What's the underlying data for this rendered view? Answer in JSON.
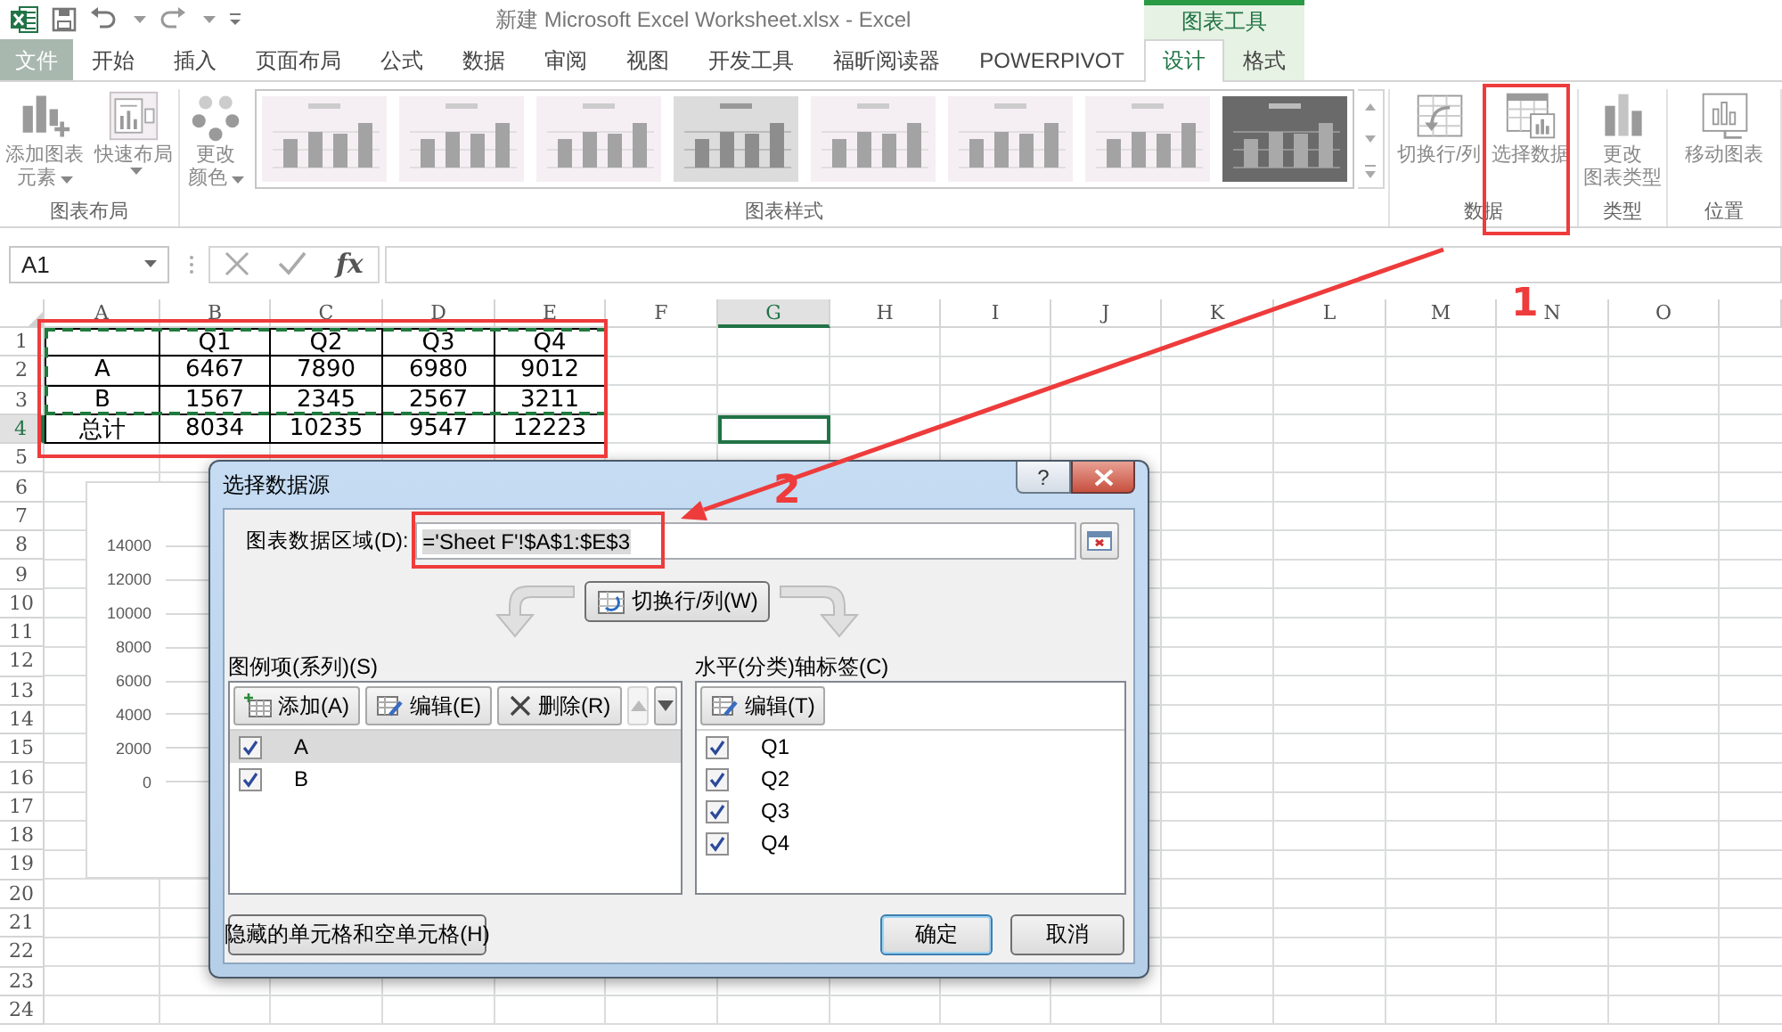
{
  "title_bar": {
    "title": "新建 Microsoft Excel Worksheet.xlsx - Excel",
    "contextual_group": "图表工具"
  },
  "tabs": [
    {
      "label": "文件",
      "kind": "file",
      "selected": false
    },
    {
      "label": "开始",
      "kind": "normal",
      "selected": false
    },
    {
      "label": "插入",
      "kind": "normal",
      "selected": false
    },
    {
      "label": "页面布局",
      "kind": "normal",
      "selected": false
    },
    {
      "label": "公式",
      "kind": "normal",
      "selected": false
    },
    {
      "label": "数据",
      "kind": "normal",
      "selected": false
    },
    {
      "label": "审阅",
      "kind": "normal",
      "selected": false
    },
    {
      "label": "视图",
      "kind": "normal",
      "selected": false
    },
    {
      "label": "开发工具",
      "kind": "normal",
      "selected": false
    },
    {
      "label": "福昕阅读器",
      "kind": "normal",
      "selected": false
    },
    {
      "label": "POWERPIVOT",
      "kind": "normal",
      "selected": false
    },
    {
      "label": "设计",
      "kind": "contextual",
      "selected": true
    },
    {
      "label": "格式",
      "kind": "contextual",
      "selected": false
    }
  ],
  "ribbon": {
    "groups": [
      {
        "label": "图表布局",
        "buttons": [
          {
            "label": [
              "添加图表",
              "元素"
            ],
            "dropdown": true
          },
          {
            "label": [
              "快速布局"
            ],
            "dropdown": true
          }
        ]
      },
      {
        "label": "图表样式",
        "buttons": [
          {
            "label": [
              "更改",
              "颜色"
            ],
            "dropdown": true
          }
        ],
        "styles": [
          {
            "kind": "light"
          },
          {
            "kind": "light"
          },
          {
            "kind": "light"
          },
          {
            "kind": "shaded"
          },
          {
            "kind": "light"
          },
          {
            "kind": "light"
          },
          {
            "kind": "light"
          },
          {
            "kind": "dark"
          }
        ]
      },
      {
        "label": "数据",
        "buttons": [
          {
            "label": [
              "切换行/列"
            ],
            "dropdown": false
          },
          {
            "label": [
              "选择数据"
            ],
            "dropdown": false
          }
        ]
      },
      {
        "label": "类型",
        "buttons": [
          {
            "label": [
              "更改",
              "图表类型"
            ],
            "dropdown": false
          }
        ]
      },
      {
        "label": "位置",
        "buttons": [
          {
            "label": [
              "移动图表"
            ],
            "dropdown": false
          }
        ]
      }
    ]
  },
  "formula_bar": {
    "name_box": "A1",
    "function_label": "fx"
  },
  "sheet": {
    "columns": [
      {
        "label": "A",
        "selected": false
      },
      {
        "label": "B",
        "selected": false
      },
      {
        "label": "C",
        "selected": false
      },
      {
        "label": "D",
        "selected": false
      },
      {
        "label": "E",
        "selected": false
      },
      {
        "label": "F",
        "selected": false
      },
      {
        "label": "G",
        "selected": true
      },
      {
        "label": "H",
        "selected": false
      },
      {
        "label": "I",
        "selected": false
      },
      {
        "label": "J",
        "selected": false
      },
      {
        "label": "K",
        "selected": false
      },
      {
        "label": "L",
        "selected": false
      },
      {
        "label": "M",
        "selected": false
      },
      {
        "label": "N",
        "selected": false
      },
      {
        "label": "O",
        "selected": false
      }
    ],
    "rows": [
      {
        "label": "1",
        "selected": false
      },
      {
        "label": "2",
        "selected": false
      },
      {
        "label": "3",
        "selected": false
      },
      {
        "label": "4",
        "selected": true
      },
      {
        "label": "5",
        "selected": false
      },
      {
        "label": "6",
        "selected": false
      },
      {
        "label": "7",
        "selected": false
      },
      {
        "label": "8",
        "selected": false
      },
      {
        "label": "9",
        "selected": false
      },
      {
        "label": "10",
        "selected": false
      },
      {
        "label": "11",
        "selected": false
      },
      {
        "label": "12",
        "selected": false
      },
      {
        "label": "13",
        "selected": false
      },
      {
        "label": "14",
        "selected": false
      },
      {
        "label": "15",
        "selected": false
      },
      {
        "label": "16",
        "selected": false
      },
      {
        "label": "17",
        "selected": false
      },
      {
        "label": "18",
        "selected": false
      },
      {
        "label": "19",
        "selected": false
      },
      {
        "label": "20",
        "selected": false
      },
      {
        "label": "21",
        "selected": false
      },
      {
        "label": "22",
        "selected": false
      },
      {
        "label": "23",
        "selected": false
      },
      {
        "label": "24",
        "selected": false
      }
    ],
    "table": {
      "header": [
        "Q1",
        "Q2",
        "Q3",
        "Q4"
      ],
      "rows": [
        {
          "label": "A",
          "values": [
            "6467",
            "7890",
            "6980",
            "9012"
          ]
        },
        {
          "label": "B",
          "values": [
            "1567",
            "2345",
            "2567",
            "3211"
          ]
        },
        {
          "label": "总计",
          "values": [
            "8034",
            "10235",
            "9547",
            "12223"
          ]
        }
      ]
    },
    "chart": {
      "axis_labels": [
        "14000",
        "12000",
        "10000",
        "8000",
        "6000",
        "4000",
        "2000",
        "0"
      ]
    }
  },
  "dialog": {
    "title": "选择数据源",
    "help_button": "?",
    "range_label": "图表数据区域(D):",
    "range_value": "='Sheet F'!$A$1:$E$3",
    "switch_button": "切换行/列(W)",
    "series_label": "图例项(系列)(S)",
    "series_buttons": [
      {
        "kind": "add",
        "label": "添加(A)",
        "disabled": false
      },
      {
        "kind": "edit",
        "label": "编辑(E)",
        "disabled": false
      },
      {
        "kind": "delete",
        "label": "删除(R)",
        "disabled": false
      },
      {
        "kind": "up",
        "disabled": true
      },
      {
        "kind": "down",
        "disabled": false
      }
    ],
    "series": [
      {
        "label": "A",
        "checked": true,
        "selected": true
      },
      {
        "label": "B",
        "checked": true,
        "selected": false
      }
    ],
    "category_label": "水平(分类)轴标签(C)",
    "category_buttons": [
      {
        "kind": "edit",
        "label": "编辑(T)",
        "disabled": false
      }
    ],
    "categories": [
      {
        "label": "Q1",
        "checked": true
      },
      {
        "label": "Q2",
        "checked": true
      },
      {
        "label": "Q3",
        "checked": true
      },
      {
        "label": "Q4",
        "checked": true
      }
    ],
    "hidden_cells_button": "隐藏的单元格和空单元格(H)",
    "ok_button": "确定",
    "cancel_button": "取消"
  },
  "annotations": [
    {
      "label": "1"
    },
    {
      "label": "2"
    }
  ]
}
